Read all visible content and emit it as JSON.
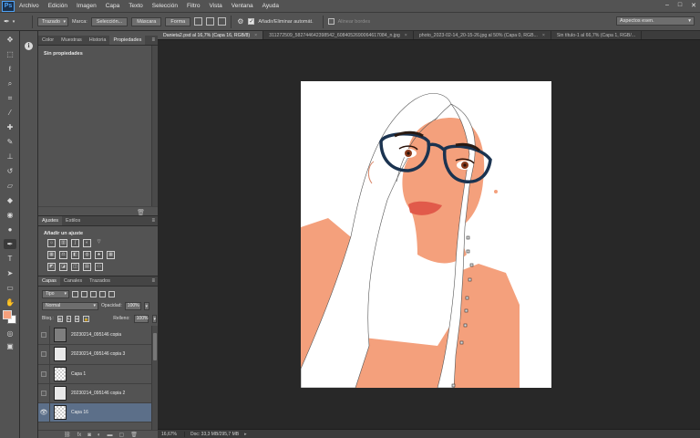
{
  "menu": {
    "logo": "Ps",
    "items": [
      "Archivo",
      "Edición",
      "Imagen",
      "Capa",
      "Texto",
      "Selección",
      "Filtro",
      "Vista",
      "Ventana",
      "Ayuda"
    ],
    "window_controls": [
      "–",
      "□",
      "✕"
    ]
  },
  "options": {
    "mode": "Trazado",
    "marca_label": "Marca:",
    "seleccion": "Selección...",
    "mascara": "Máscara",
    "forma": "Forma",
    "auto_add_label": "Añadir/Eliminar automát.",
    "align_label": "Alinear bordes",
    "workspace": "Aspectos esen."
  },
  "doc_tabs": [
    "Danieta2.psd al 16,7% (Capa 16, RGB/8)",
    "311272509_582744642398542_6084052690064617084_n.jpg",
    "photo_2023-02-14_20-15-26.jpg al 50% (Capa 0, RGB...",
    "Sin título-1 al 66,7% (Capa 1, RGB/..."
  ],
  "properties": {
    "tabs": [
      "Color",
      "Muestras",
      "Historia",
      "Propiedades"
    ],
    "active_tab": 3,
    "content": "Sin propiedades"
  },
  "adjustments": {
    "tabs": [
      "Ajustes",
      "Estilos"
    ],
    "title": "Añadir un ajuste"
  },
  "layers": {
    "tabs": [
      "Capas",
      "Canales",
      "Trazados"
    ],
    "filter": "Tipo",
    "blend": "Normal",
    "opacity_label": "Opacidad:",
    "opacity": "100%",
    "lock_label": "Bloq.:",
    "fill_label": "Relleno:",
    "fill": "100%",
    "items": [
      {
        "name": "20230214_095146 copia",
        "visible": false,
        "thumb": "dark",
        "selected": false
      },
      {
        "name": "20230214_095146 copia 3",
        "visible": false,
        "thumb": "img",
        "selected": false
      },
      {
        "name": "Capa 1",
        "visible": false,
        "thumb": "checker",
        "selected": false
      },
      {
        "name": "20230214_095146 copia 2",
        "visible": false,
        "thumb": "img",
        "selected": false
      },
      {
        "name": "Capa 16",
        "visible": true,
        "thumb": "checker",
        "selected": true
      }
    ],
    "footer_icons": [
      "link-icon",
      "fx-icon",
      "mask-icon",
      "adjustment-icon",
      "folder-icon",
      "new-layer-icon",
      "trash-icon"
    ]
  },
  "status": {
    "zoom": "16,67%",
    "doc": "Doc: 33,3 MB/295,7 MB"
  },
  "colors": {
    "foreground": "#f4a07c",
    "background": "#ffffff",
    "skin": "#f4a07c",
    "glasses": "#1b3350"
  }
}
